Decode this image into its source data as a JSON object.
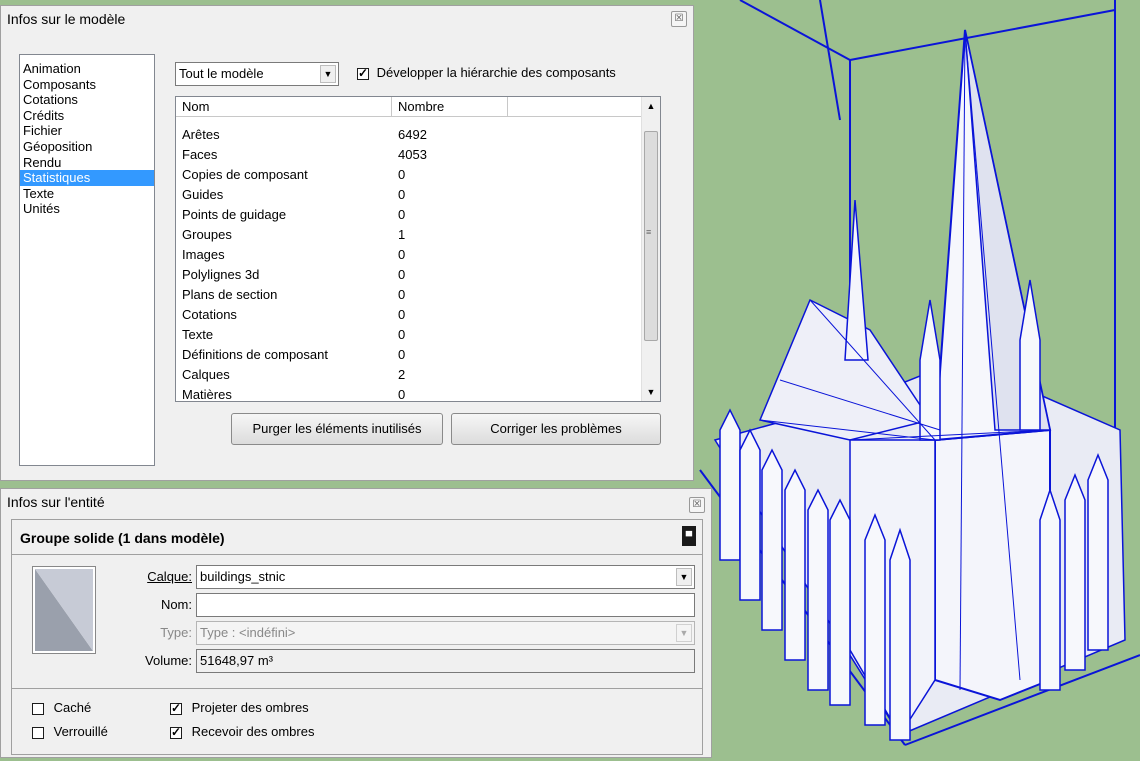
{
  "model_info": {
    "title": "Infos sur le modèle",
    "close_icon": "close-icon",
    "categories": [
      "Animation",
      "Composants",
      "Cotations",
      "Crédits",
      "Fichier",
      "Géoposition",
      "Rendu",
      "Statistiques",
      "Texte",
      "Unités"
    ],
    "selected_category": "Statistiques",
    "scope_select": "Tout le modèle",
    "expand_checkbox_label": "Développer la hiérarchie des composants",
    "expand_checked": true,
    "table": {
      "headers": [
        "Nom",
        "Nombre"
      ],
      "rows": [
        {
          "name": "Arêtes",
          "count": "6492"
        },
        {
          "name": "Faces",
          "count": "4053"
        },
        {
          "name": "Copies de composant",
          "count": "0"
        },
        {
          "name": "Guides",
          "count": "0"
        },
        {
          "name": "Points de guidage",
          "count": "0"
        },
        {
          "name": "Groupes",
          "count": "1"
        },
        {
          "name": "Images",
          "count": "0"
        },
        {
          "name": "Polylignes 3d",
          "count": "0"
        },
        {
          "name": "Plans de section",
          "count": "0"
        },
        {
          "name": "Cotations",
          "count": "0"
        },
        {
          "name": "Texte",
          "count": "0"
        },
        {
          "name": "Définitions de composant",
          "count": "0"
        },
        {
          "name": "Calques",
          "count": "2"
        },
        {
          "name": "Matières",
          "count": "0"
        }
      ]
    },
    "purge_button": "Purger les éléments inutilisés",
    "fix_button": "Corriger les problèmes"
  },
  "entity_info": {
    "title": "Infos sur l'entité",
    "heading": "Groupe solide (1 dans modèle)",
    "layer_label": "Calque:",
    "layer_value": "buildings_stnic",
    "name_label": "Nom:",
    "name_value": "",
    "type_label": "Type:",
    "type_value": "Type : <indéfini>",
    "volume_label": "Volume:",
    "volume_value": "51648,97 m³",
    "hidden_label": "Caché",
    "locked_label": "Verrouillé",
    "cast_shadows_label": "Projeter des ombres",
    "receive_shadows_label": "Recevoir des ombres",
    "hidden_checked": false,
    "locked_checked": false,
    "cast_checked": true,
    "receive_checked": true
  },
  "colors": {
    "viewport_bg": "#9cbf8f",
    "model_edges": "#0a14d8",
    "selection": "#3399ff"
  }
}
